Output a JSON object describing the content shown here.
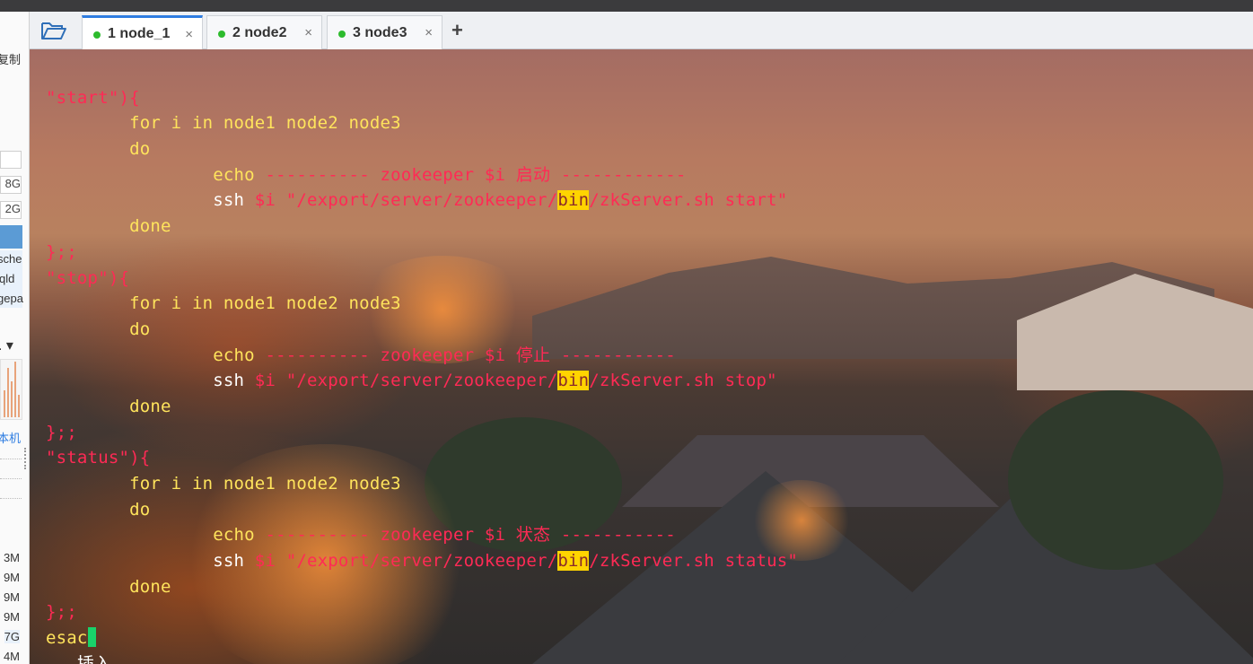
{
  "tabs": [
    {
      "label": "1 node_1",
      "close": "×"
    },
    {
      "label": "2 node2",
      "close": "×"
    },
    {
      "label": "3 node3",
      "close": "×"
    }
  ],
  "new_tab": "+",
  "left_panel": {
    "texts": [
      "复制",
      "8G",
      "2G",
      "sche",
      "qld",
      "gepa",
      "本机",
      "3M",
      "9M",
      "9M",
      "9M",
      "7G",
      "4M"
    ]
  },
  "terminal": {
    "start_case": "\"start\"){",
    "for_line": "for i in node1 node2 node3",
    "do": "do",
    "echo_kw": "echo",
    "echo_dash_a": "----------",
    "echo_zk": "zookeeper $i",
    "start_word": "启动",
    "echo_dash_b_start": "------------",
    "ssh_kw": "ssh",
    "ssh_var": "$i",
    "ssh_path_pre": "\"/export/server/zookeeper/",
    "bin": "bin",
    "ssh_start_tail": "/zkServer.sh start\"",
    "done": "done",
    "case_end": "};;",
    "stop_case": "\"stop\"){",
    "stop_word": "停止",
    "echo_dash_b": "-----------",
    "ssh_stop_tail": "/zkServer.sh stop\"",
    "status_case": "\"status\"){",
    "status_word": "状态",
    "ssh_status_tail": "/zkServer.sh status\"",
    "esac": "esac",
    "mode": "-- 插入 --"
  }
}
